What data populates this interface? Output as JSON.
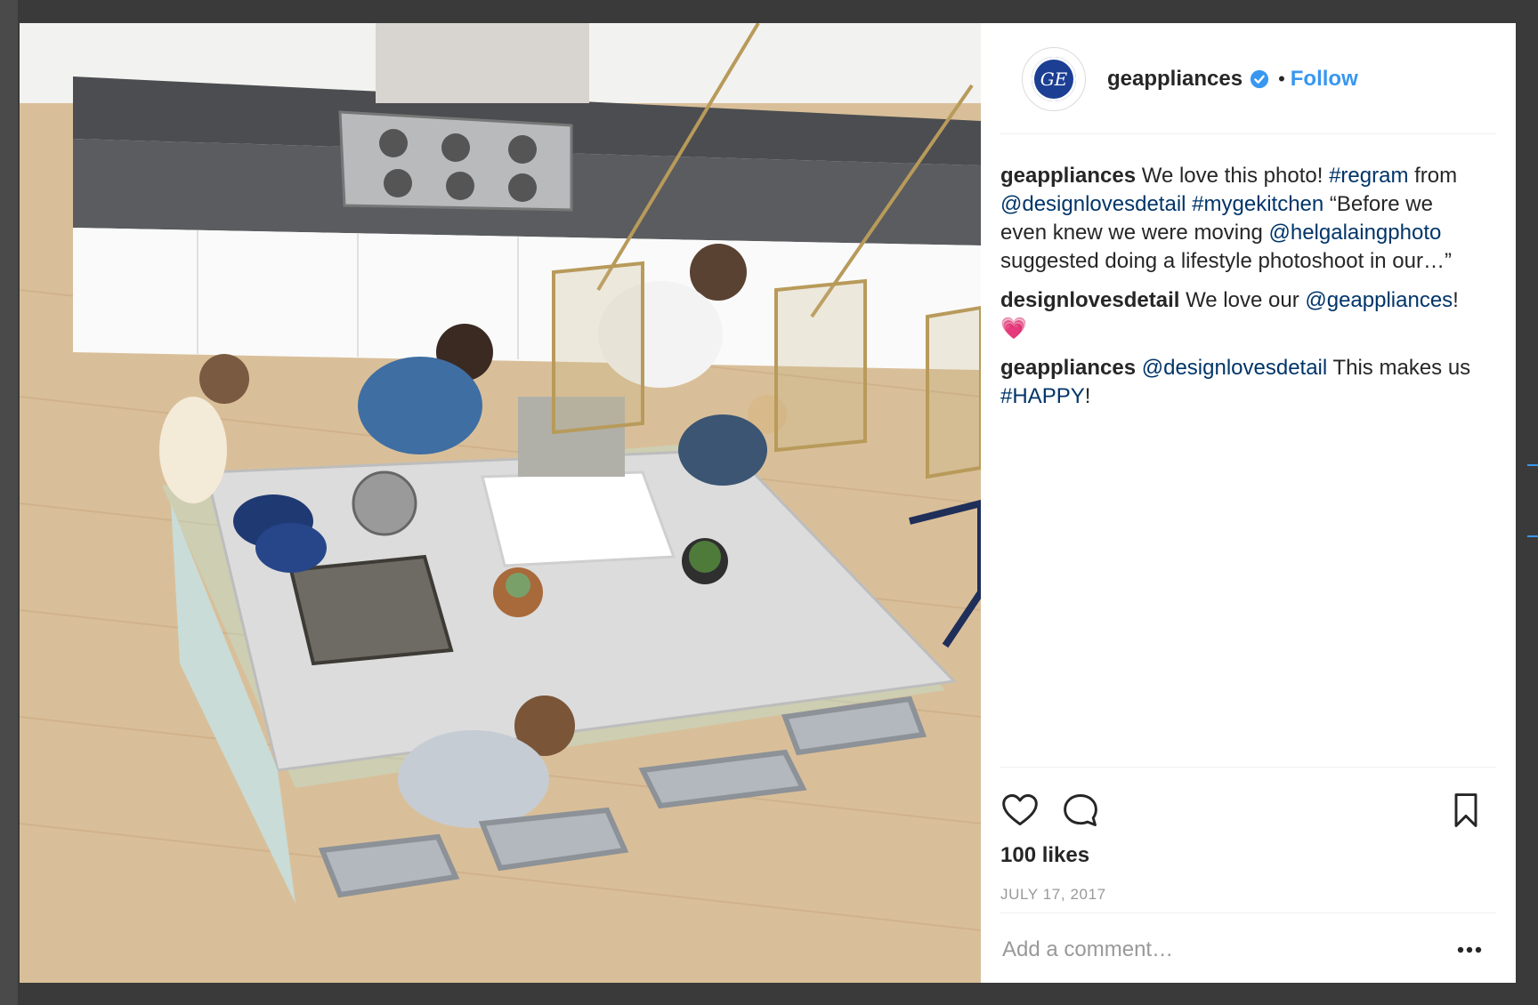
{
  "post": {
    "username": "geappliances",
    "avatar_text": "GE",
    "separator": "•",
    "follow_label": "Follow",
    "comments": [
      {
        "author": "geappliances",
        "parts": [
          {
            "text": " We love this photo! "
          },
          {
            "text": "#regram",
            "link": true
          },
          {
            "text": " from "
          },
          {
            "text": "@designlovesdetail",
            "link": true
          },
          {
            "text": " "
          },
          {
            "text": "#mygekitchen",
            "link": true
          },
          {
            "text": " “Before we even knew we were moving "
          },
          {
            "text": "@helgalaingphoto",
            "link": true
          },
          {
            "text": " suggested doing a lifestyle photoshoot in our…”"
          }
        ]
      },
      {
        "author": "designlovesdetail",
        "parts": [
          {
            "text": " We love our "
          },
          {
            "text": "@geappliances",
            "link": true
          },
          {
            "text": "! 💗"
          }
        ]
      },
      {
        "author": "geappliances",
        "parts": [
          {
            "text": " "
          },
          {
            "text": "@designlovesdetail",
            "link": true
          },
          {
            "text": " This makes us "
          },
          {
            "text": "#HAPPY",
            "link": true
          },
          {
            "text": "!"
          }
        ]
      }
    ],
    "likes": "100 likes",
    "date": "JULY 17, 2017",
    "comment_placeholder": "Add a comment…"
  },
  "icons": {
    "like": "heart-icon",
    "comment": "comment-bubble-icon",
    "save": "bookmark-icon",
    "more": "ellipsis-icon",
    "verified": "verified-badge-icon"
  },
  "colors": {
    "link": "#003569",
    "follow": "#3897f0",
    "text": "#262626",
    "muted": "#999999",
    "ge_blue": "#1c3f94"
  }
}
